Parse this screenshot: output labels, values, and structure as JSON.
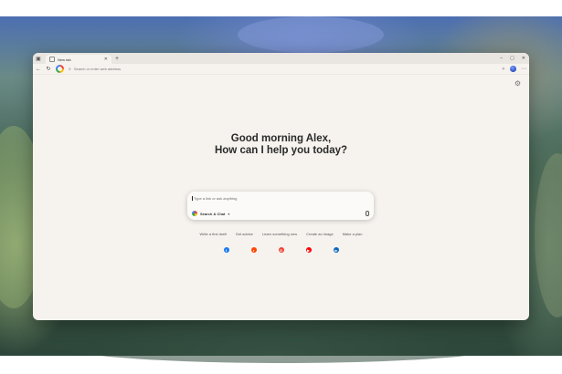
{
  "colors": {
    "window_bg": "#f6f3ef",
    "tabstrip_bg": "#e9e5e1",
    "greeting_text": "#2a2a2a"
  },
  "tab": {
    "title": "New tab",
    "favicon": "new-tab-favicon",
    "close_icon": "close-icon"
  },
  "window_controls": [
    "–",
    "▢",
    "✕"
  ],
  "omnibox": {
    "placeholder": "Search or enter web address"
  },
  "greeting": {
    "line1": "Good morning Alex,",
    "line2": "How can I help you today?"
  },
  "prompt": {
    "placeholder": "Type a link or ask anything",
    "mode_label": "Search & Chat",
    "mode_chevron": "▾"
  },
  "suggestions": [
    "Write a first draft",
    "Get advice",
    "Learn something new",
    "Create an image",
    "Make a plan"
  ],
  "shortcuts": [
    {
      "name": "facebook-icon",
      "glyph": "f",
      "color": "#1877f2"
    },
    {
      "name": "reddit-icon",
      "glyph": "r",
      "color": "#ff4500"
    },
    {
      "name": "google-icon",
      "glyph": "G",
      "color": "#ea4335"
    },
    {
      "name": "youtube-icon",
      "glyph": "▶",
      "color": "#ff0000"
    },
    {
      "name": "linkedin-icon",
      "glyph": "in",
      "color": "#0a66c2"
    }
  ]
}
